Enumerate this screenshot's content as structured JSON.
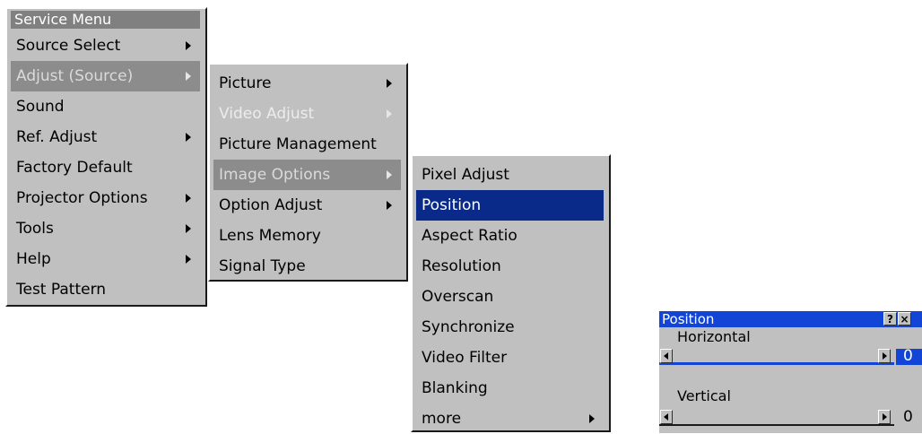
{
  "service_menu": {
    "title": "Service Menu",
    "items": [
      {
        "label": "Source Select",
        "submenu": true
      },
      {
        "label": "Adjust (Source)",
        "submenu": true
      },
      {
        "label": "Sound",
        "submenu": false
      },
      {
        "label": "Ref. Adjust",
        "submenu": true
      },
      {
        "label": "Factory Default",
        "submenu": false
      },
      {
        "label": "Projector Options",
        "submenu": true
      },
      {
        "label": "Tools",
        "submenu": true
      },
      {
        "label": "Help",
        "submenu": true
      },
      {
        "label": "Test Pattern",
        "submenu": false
      }
    ]
  },
  "adjust_menu": {
    "items": [
      {
        "label": "Picture",
        "submenu": true
      },
      {
        "label": "Video Adjust",
        "submenu": true
      },
      {
        "label": "Picture Management",
        "submenu": false
      },
      {
        "label": "Image Options",
        "submenu": true
      },
      {
        "label": "Option Adjust",
        "submenu": true
      },
      {
        "label": "Lens Memory",
        "submenu": false
      },
      {
        "label": "Signal Type",
        "submenu": false
      }
    ]
  },
  "image_options_menu": {
    "items": [
      {
        "label": "Pixel Adjust",
        "submenu": false
      },
      {
        "label": "Position",
        "submenu": false
      },
      {
        "label": "Aspect Ratio",
        "submenu": false
      },
      {
        "label": "Resolution",
        "submenu": false
      },
      {
        "label": "Overscan",
        "submenu": false
      },
      {
        "label": "Synchronize",
        "submenu": false
      },
      {
        "label": "Video Filter",
        "submenu": false
      },
      {
        "label": "Blanking",
        "submenu": false
      },
      {
        "label": "more",
        "submenu": true
      }
    ]
  },
  "position_dialog": {
    "title": "Position",
    "help_label": "?",
    "close_label": "×",
    "horizontal_label": "Horizontal",
    "horizontal_value": "0",
    "vertical_label": "Vertical",
    "vertical_value": "0"
  }
}
